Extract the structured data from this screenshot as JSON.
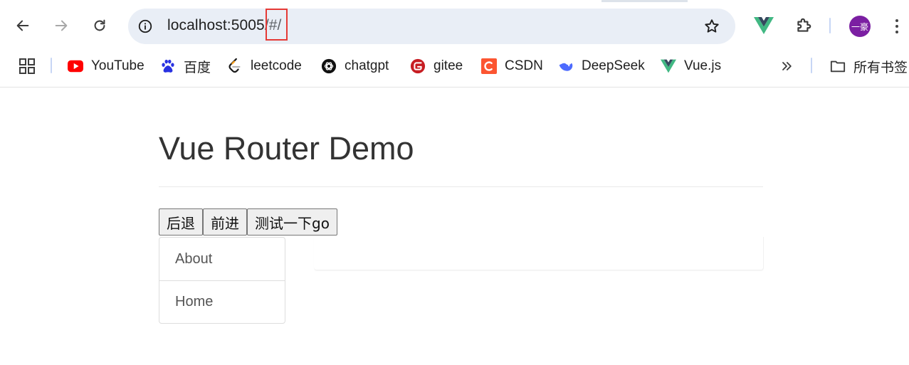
{
  "browser": {
    "url_host": "localhost:5005",
    "url_path": "/#/",
    "avatar_text": "一豪",
    "bookmarks": [
      {
        "label": "YouTube",
        "icon": "youtube-icon"
      },
      {
        "label": "百度",
        "icon": "baidu-icon"
      },
      {
        "label": "leetcode",
        "icon": "leetcode-icon"
      },
      {
        "label": "chatgpt",
        "icon": "chatgpt-icon"
      },
      {
        "label": "gitee",
        "icon": "gitee-icon"
      },
      {
        "label": "CSDN",
        "icon": "csdn-icon"
      },
      {
        "label": "DeepSeek",
        "icon": "deepseek-icon"
      },
      {
        "label": "Vue.js",
        "icon": "vue-icon"
      }
    ],
    "all_bookmarks_label": "所有书签",
    "colors": {
      "accent_red": "#e53935",
      "vue_green": "#41b883",
      "avatar": "#7b1fa2"
    }
  },
  "page": {
    "title": "Vue Router Demo",
    "buttons": {
      "back": "后退",
      "forward": "前进",
      "go_test": "测试一下go"
    },
    "nav_links": [
      {
        "label": "About"
      },
      {
        "label": "Home"
      }
    ]
  }
}
